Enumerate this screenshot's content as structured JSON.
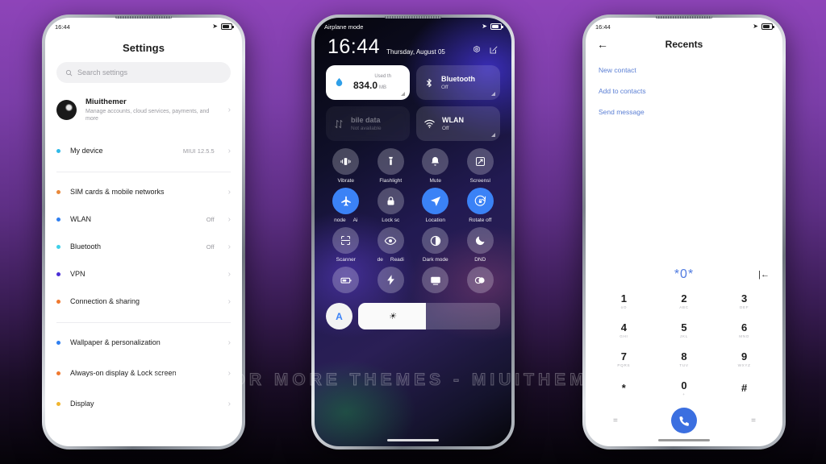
{
  "watermark": "VISIT FOR MORE THEMES - MIUITHEMER.COM",
  "colors": {
    "accent_blue": "#3b82f6",
    "link_blue": "#5b7fd4",
    "call_green_blue": "#3b6fe0",
    "bg_purple": "#8e44b9"
  },
  "phone1": {
    "status": {
      "time": "16:44"
    },
    "title": "Settings",
    "search": {
      "placeholder": "Search settings",
      "icon": "search-icon"
    },
    "account": {
      "name": "Miuithemer",
      "subtitle": "Manage accounts, cloud services, payments, and more"
    },
    "items": [
      {
        "label": "My device",
        "value": "MIUI 12.5.5",
        "dot": "#2fb9e8"
      },
      {
        "label": "SIM cards & mobile networks",
        "value": "",
        "dot": "#e9883a"
      },
      {
        "label": "WLAN",
        "value": "Off",
        "dot": "#2f7ff0"
      },
      {
        "label": "Bluetooth",
        "value": "Off",
        "dot": "#3fd0e8"
      },
      {
        "label": "VPN",
        "value": "",
        "dot": "#4b2fd6"
      },
      {
        "label": "Connection & sharing",
        "value": "",
        "dot": "#f0792f"
      },
      {
        "label": "Wallpaper & personalization",
        "value": "",
        "dot": "#2f7ff0"
      },
      {
        "label": "Always-on display & Lock screen",
        "value": "",
        "dot": "#f0792f"
      },
      {
        "label": "Display",
        "value": "",
        "dot": "#f0b52f"
      }
    ]
  },
  "phone2": {
    "status": {
      "left": "Airplane mode"
    },
    "clock": {
      "time": "16:44",
      "date": "Thursday, August 05"
    },
    "header_icons": [
      "settings-gear-icon",
      "edit-icon"
    ],
    "big_tiles": [
      {
        "name": "data-usage",
        "kind": "data",
        "top": "Used th",
        "value": "834.0",
        "unit": "MB",
        "icon": "water-drop-icon",
        "state": "white"
      },
      {
        "name": "bluetooth",
        "label": "Bluetooth",
        "sub": "Off",
        "icon": "bluetooth-icon",
        "state": "normal"
      },
      {
        "name": "mobile-data",
        "label": "bile data",
        "sub": "Not available",
        "icon": "data-arrows-icon",
        "state": "faded"
      },
      {
        "name": "wlan",
        "label": "WLAN",
        "sub": "Off",
        "icon": "wifi-icon",
        "state": "normal"
      }
    ],
    "toggles": [
      {
        "label": "Vibrate",
        "icon": "vibrate-icon",
        "on": false
      },
      {
        "label": "Flashlight",
        "icon": "flashlight-icon",
        "on": false
      },
      {
        "label": "Mute",
        "icon": "bell-icon",
        "on": false
      },
      {
        "label": "Screensl",
        "icon": "screenshot-icon",
        "on": false
      },
      {
        "label": "node",
        "label2": "Ai",
        "icon": "airplane-icon",
        "on": true
      },
      {
        "label": "Lock sc",
        "icon": "lock-icon",
        "on": false
      },
      {
        "label": "Location",
        "icon": "location-arrow-icon",
        "on": true
      },
      {
        "label": "Rotate off",
        "icon": "rotate-lock-icon",
        "on": true
      },
      {
        "label": "Scanner",
        "icon": "scanner-icon",
        "on": false
      },
      {
        "label": "de",
        "label2": "Readi",
        "icon": "eye-icon",
        "on": false
      },
      {
        "label": "Dark mode",
        "icon": "contrast-icon",
        "on": false
      },
      {
        "label": "DND",
        "icon": "moon-icon",
        "on": false
      },
      {
        "label": "",
        "icon": "battery-saver-icon",
        "on": false
      },
      {
        "label": "",
        "icon": "lightning-icon",
        "on": false
      },
      {
        "label": "",
        "icon": "cast-screen-icon",
        "on": false
      },
      {
        "label": "",
        "icon": "contrast-split-icon",
        "on": false
      }
    ],
    "bottom": {
      "auto_label": "A",
      "brightness_icon": "sun-icon"
    }
  },
  "phone3": {
    "status": {
      "time": "16:44"
    },
    "title": "Recents",
    "back_icon": "back-arrow-icon",
    "links": [
      "New contact",
      "Add to contacts",
      "Send message"
    ],
    "dialed_number": "*0*",
    "delete_icon": "backspace-icon",
    "keys": [
      {
        "digit": "1",
        "letters": "oO"
      },
      {
        "digit": "2",
        "letters": "ABC"
      },
      {
        "digit": "3",
        "letters": "DEF"
      },
      {
        "digit": "4",
        "letters": "GHI"
      },
      {
        "digit": "5",
        "letters": "JKL"
      },
      {
        "digit": "6",
        "letters": "MNO"
      },
      {
        "digit": "7",
        "letters": "PQRS"
      },
      {
        "digit": "8",
        "letters": "TUV"
      },
      {
        "digit": "9",
        "letters": "WXYZ"
      },
      {
        "digit": "*",
        "letters": ""
      },
      {
        "digit": "0",
        "letters": "+"
      },
      {
        "digit": "#",
        "letters": ""
      }
    ],
    "actions": {
      "left": "=",
      "right": "=",
      "call_icon": "phone-call-icon"
    }
  }
}
